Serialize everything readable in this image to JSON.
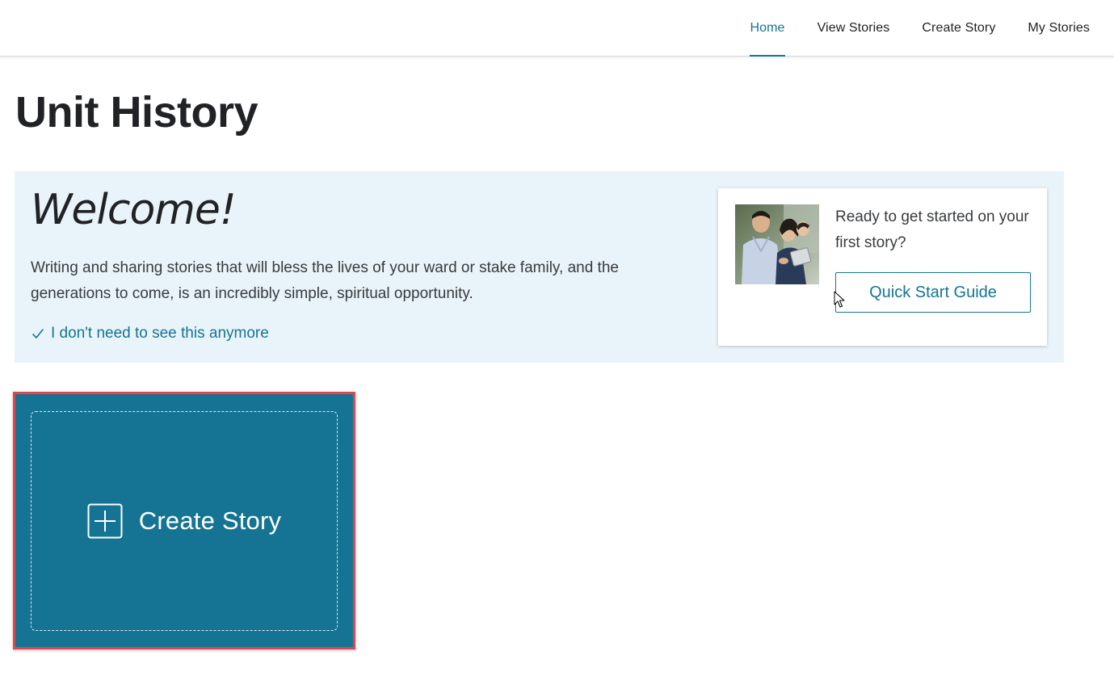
{
  "nav": {
    "items": [
      {
        "label": "Home",
        "active": true
      },
      {
        "label": "View Stories",
        "active": false
      },
      {
        "label": "Create Story",
        "active": false
      },
      {
        "label": "My Stories",
        "active": false
      }
    ]
  },
  "page": {
    "title": "Unit History"
  },
  "welcome": {
    "heading": "Welcome!",
    "body": "Writing and sharing stories that will bless the lives of your ward or stake family, and the generations to come, is an incredibly simple, spiritual opportunity.",
    "dismiss_label": "I don't need to see this anymore"
  },
  "quick_start": {
    "prompt": "Ready to get started on your first story?",
    "button_label": "Quick Start Guide"
  },
  "create_tile": {
    "label": "Create Story",
    "icon": "plus-square-icon"
  },
  "colors": {
    "accent": "#157493",
    "banner_bg": "#e8f4f9",
    "highlight_border": "#e0474c"
  }
}
